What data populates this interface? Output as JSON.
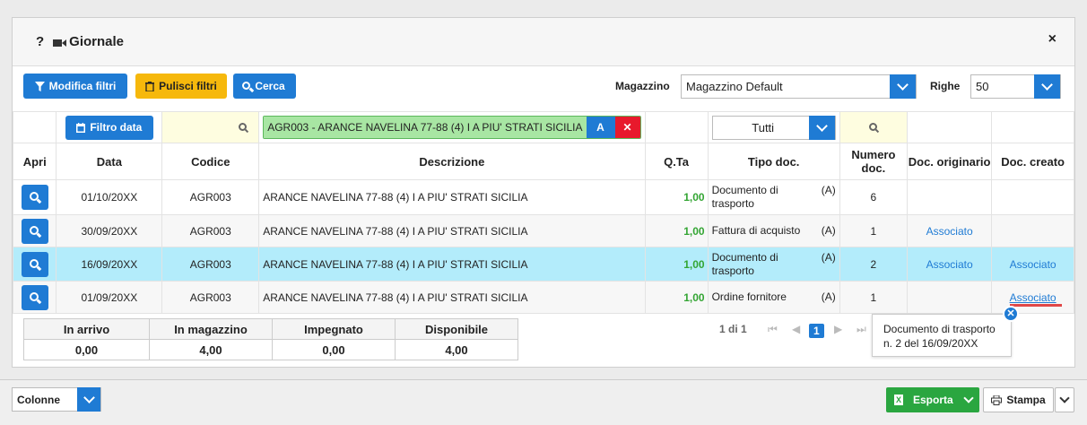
{
  "header": {
    "help": "?",
    "title": "Giornale",
    "close": "×"
  },
  "toolbar": {
    "modifica": "Modifica filtri",
    "pulisci": "Pulisci filtri",
    "cerca": "Cerca",
    "magazzino_label": "Magazzino",
    "magazzino_value": "Magazzino Default",
    "righe_label": "Righe",
    "righe_value": "50"
  },
  "filters": {
    "filtro_data": "Filtro data",
    "descrizione": "AGR003 - ARANCE NAVELINA 77-88 (4) I A PIU' STRATI SICILIA",
    "a_btn": "A",
    "clear": "✕",
    "tipo": "Tutti"
  },
  "columns": [
    "Apri",
    "Data",
    "Codice",
    "Descrizione",
    "Q.Ta",
    "Tipo doc.",
    "Numero doc.",
    "Doc. originario",
    "Doc. creato"
  ],
  "rows": [
    {
      "data": "01/10/20XX",
      "codice": "AGR003",
      "descrizione": "ARANCE NAVELINA 77-88 (4) I A PIU' STRATI SICILIA",
      "qta": "1,00",
      "tipo": "Documento di trasporto",
      "tipo_flag": "(A)",
      "numero": "6",
      "orig": "",
      "creato": ""
    },
    {
      "data": "30/09/20XX",
      "codice": "AGR003",
      "descrizione": "ARANCE NAVELINA 77-88 (4) I A PIU' STRATI SICILIA",
      "qta": "1,00",
      "tipo": "Fattura di acquisto",
      "tipo_flag": "(A)",
      "numero": "1",
      "orig": "Associato",
      "creato": ""
    },
    {
      "data": "16/09/20XX",
      "codice": "AGR003",
      "descrizione": "ARANCE NAVELINA 77-88 (4) I A PIU' STRATI SICILIA",
      "qta": "1,00",
      "tipo": "Documento di trasporto",
      "tipo_flag": "(A)",
      "numero": "2",
      "orig": "Associato",
      "creato": "Associato"
    },
    {
      "data": "01/09/20XX",
      "codice": "AGR003",
      "descrizione": "ARANCE NAVELINA 77-88 (4) I A PIU' STRATI SICILIA",
      "qta": "1,00",
      "tipo": "Ordine fornitore",
      "tipo_flag": "(A)",
      "numero": "1",
      "orig": "",
      "creato": "Associato"
    }
  ],
  "summary": {
    "headers": [
      "In arrivo",
      "In magazzino",
      "Impegnato",
      "Disponibile"
    ],
    "values": [
      "0,00",
      "4,00",
      "0,00",
      "4,00"
    ]
  },
  "pager": {
    "info": "1 di 1",
    "current": "1"
  },
  "tooltip": {
    "line1": "Documento di trasporto",
    "line2": "n. 2 del 16/09/20XX"
  },
  "footer": {
    "colonne": "Colonne",
    "esporta": "Esporta",
    "stampa": "Stampa"
  },
  "colors": {
    "accent": "#1f7bd4",
    "warning": "#f6b80c",
    "success": "#2aa640",
    "danger": "#e8192c",
    "selected_row": "#b3ecfb"
  }
}
